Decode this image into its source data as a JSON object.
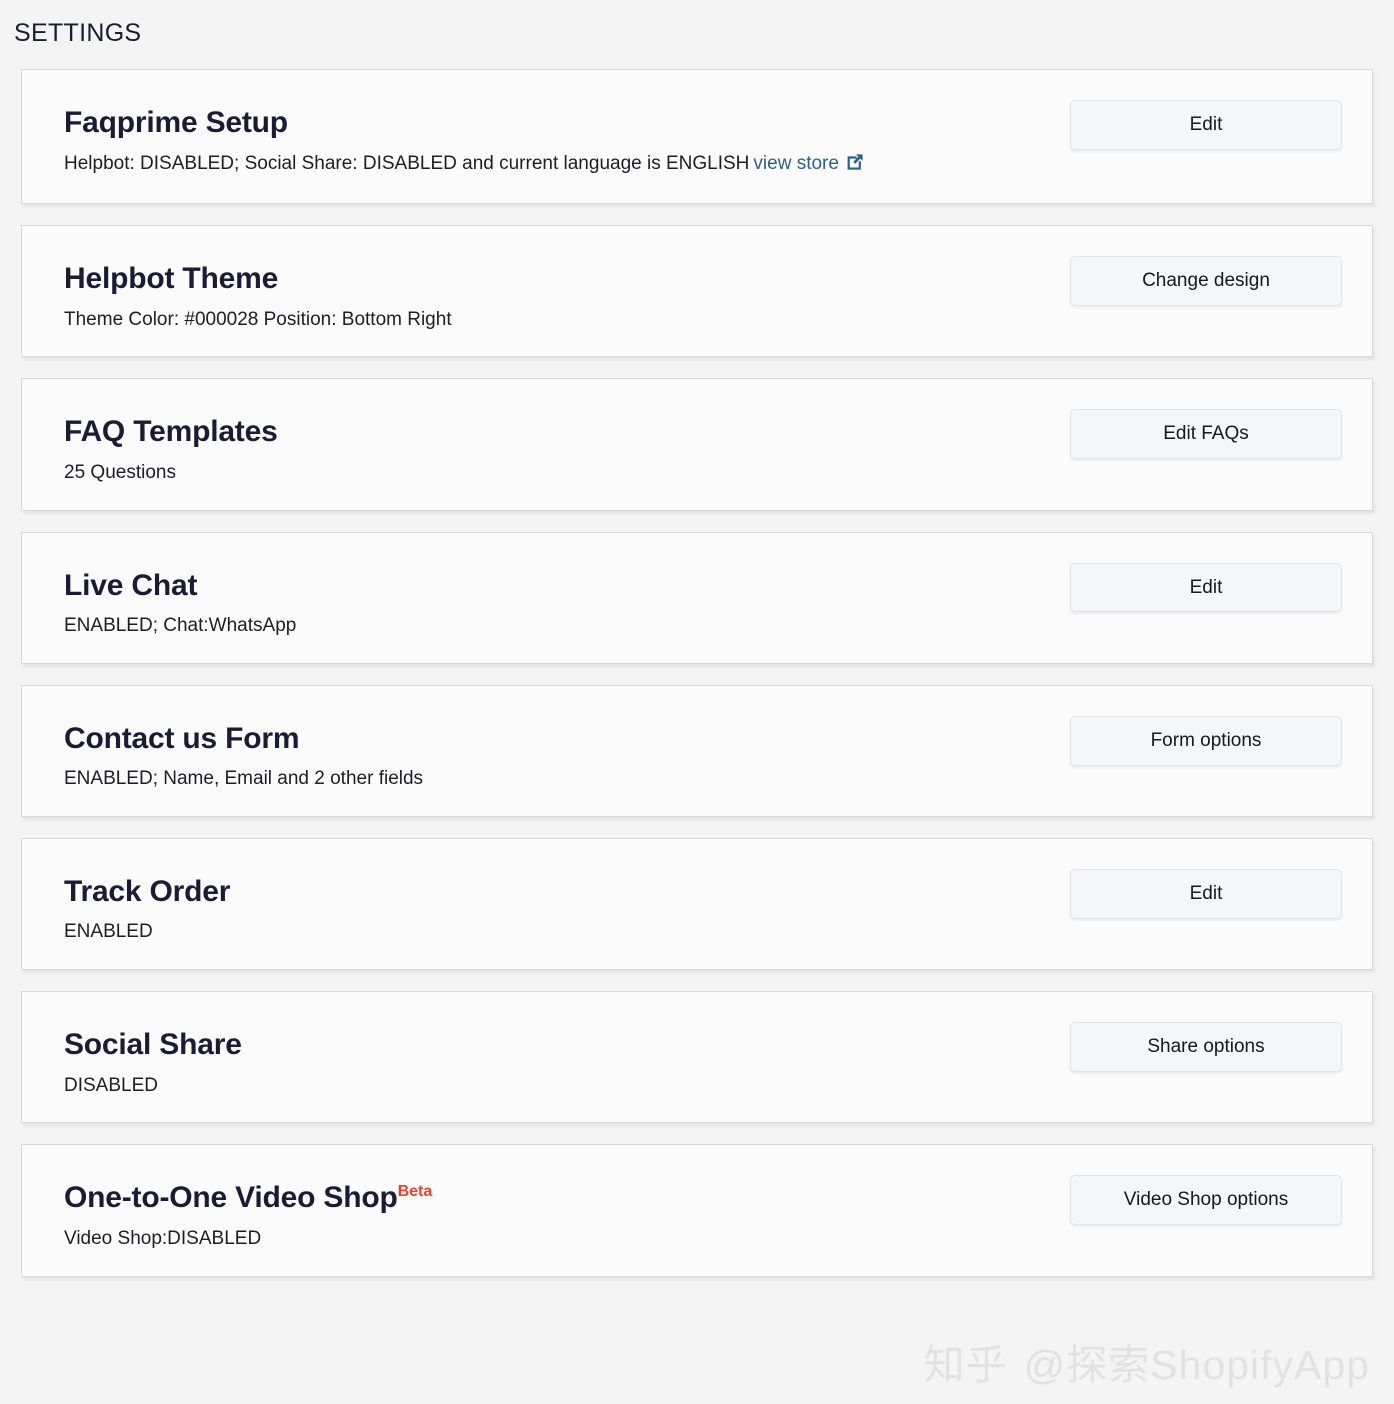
{
  "page": {
    "title": "SETTINGS"
  },
  "watermark": {
    "brand": "知乎",
    "handle": "@探索ShopifyApp"
  },
  "icons": {
    "external_link": "external-link-icon"
  },
  "cards": [
    {
      "title": "Faqprime Setup",
      "desc": "Helpbot: DISABLED; Social Share: DISABLED and current language is ENGLISH",
      "link_label": "view store",
      "has_link": true,
      "button": "Edit"
    },
    {
      "title": "Helpbot Theme",
      "desc": "Theme Color: #000028 Position: Bottom Right",
      "has_link": false,
      "button": "Change design"
    },
    {
      "title": "FAQ Templates",
      "desc": "25 Questions",
      "has_link": false,
      "button": "Edit FAQs"
    },
    {
      "title": "Live Chat",
      "desc": "ENABLED; Chat:WhatsApp",
      "has_link": false,
      "button": "Edit"
    },
    {
      "title": "Contact us Form",
      "desc": "ENABLED; Name, Email and 2 other fields",
      "has_link": false,
      "button": "Form options"
    },
    {
      "title": "Track Order",
      "desc": "ENABLED",
      "has_link": false,
      "button": "Edit"
    },
    {
      "title": "Social Share",
      "desc": "DISABLED",
      "has_link": false,
      "button": "Share options"
    },
    {
      "title": "One-to-One Video Shop",
      "badge": "Beta",
      "desc": "Video Shop:DISABLED",
      "has_link": false,
      "button": "Video Shop options"
    }
  ],
  "colors": {
    "page_bg": "#f4f4f4",
    "card_bg": "#fbfbfb",
    "card_border": "#d9d9d9",
    "heading": "#1b1b35",
    "link": "#2b6286",
    "badge": "#e8432b",
    "button_bg": "#f5f6f7",
    "watermark": "#e2e2e2"
  }
}
